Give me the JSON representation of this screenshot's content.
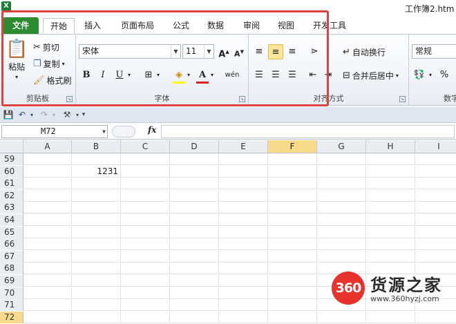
{
  "title_bar": {
    "app_icon": "X",
    "title": "工作簿2.htm"
  },
  "tabs": [
    {
      "label": "文件"
    },
    {
      "label": "开始"
    },
    {
      "label": "插入"
    },
    {
      "label": "页面布局"
    },
    {
      "label": "公式"
    },
    {
      "label": "数据"
    },
    {
      "label": "审阅"
    },
    {
      "label": "视图"
    },
    {
      "label": "开发工具"
    }
  ],
  "clipboard": {
    "paste_label": "粘贴",
    "cut_label": "剪切",
    "copy_label": "复制",
    "format_painter_label": "格式刷",
    "group_label": "剪贴板"
  },
  "font": {
    "font_name": "宋体",
    "font_size": "11",
    "grow_label": "A",
    "shrink_label": "A",
    "bold_label": "B",
    "italic_label": "I",
    "underline_label": "U",
    "wen_label": "wén",
    "group_label": "字体"
  },
  "alignment": {
    "wrap_text_label": "自动换行",
    "merge_center_label": "合并后居中",
    "group_label": "对齐方式"
  },
  "number": {
    "format_value": "常规",
    "percent_label": "%",
    "group_label": "数字"
  },
  "formula_bar": {
    "name_box": "M72",
    "fx_label": "fx",
    "formula_value": ""
  },
  "grid": {
    "columns": [
      "A",
      "B",
      "C",
      "D",
      "E",
      "F",
      "G",
      "H",
      "I"
    ],
    "selected_column": "F",
    "rows": [
      {
        "num": "59",
        "b": ""
      },
      {
        "num": "60",
        "b": "1231"
      },
      {
        "num": "61",
        "b": ""
      },
      {
        "num": "62",
        "b": ""
      },
      {
        "num": "63",
        "b": ""
      },
      {
        "num": "64",
        "b": ""
      },
      {
        "num": "65",
        "b": ""
      },
      {
        "num": "66",
        "b": ""
      },
      {
        "num": "67",
        "b": ""
      },
      {
        "num": "68",
        "b": ""
      },
      {
        "num": "69",
        "b": ""
      },
      {
        "num": "70",
        "b": ""
      },
      {
        "num": "71",
        "b": ""
      },
      {
        "num": "72",
        "b": ""
      }
    ],
    "selected_row": "72"
  },
  "watermark": {
    "logo_text": "360",
    "brand": "货源之家",
    "url": "www.360hyzj.com"
  },
  "colors": {
    "file_tab": "#2a8b2f",
    "highlight": "#e0403f",
    "selection": "#f9d98a"
  }
}
